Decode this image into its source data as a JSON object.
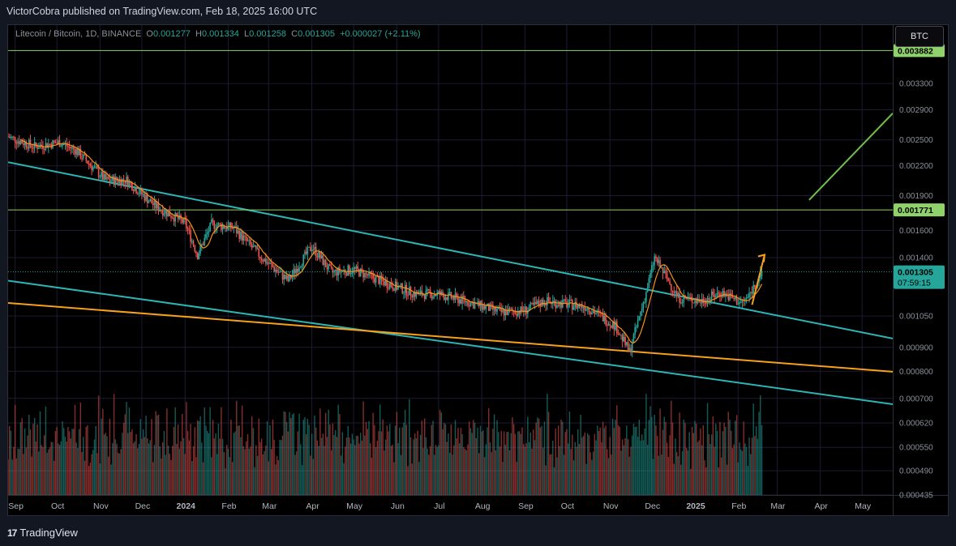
{
  "header": {
    "publisher": "VictorCobra published on TradingView.com, Feb 18, 2025 16:00 UTC"
  },
  "legend": {
    "symbol": "Litecoin / Bitcoin, 1D, BINANCE",
    "o_label": "O",
    "o_value": "0.001277",
    "h_label": "H",
    "h_value": "0.001334",
    "l_label": "L",
    "l_value": "0.001258",
    "c_label": "C",
    "c_value": "0.001305",
    "change": "+0.000027 (+2.11%)"
  },
  "symbol_box": "BTC",
  "footer": {
    "brand": "TradingView",
    "logo_mark": "17"
  },
  "colors": {
    "background": "#000000",
    "grid": "#1e1a33",
    "up": "#26a69a",
    "down": "#ef5350",
    "ma": "#f7931a",
    "channel": "#2db5b5",
    "orange_line": "#f7a11a",
    "level_line": "#8fd16a",
    "projection": "#6fc24a"
  },
  "chart_data": {
    "type": "candlestick",
    "title": "Litecoin / Bitcoin, 1D, BINANCE",
    "scale": "log",
    "ylim": [
      0.000435,
      0.0044
    ],
    "y_ticks": [
      "0.003300",
      "0.002900",
      "0.002500",
      "0.002200",
      "0.001900",
      "0.001600",
      "0.001400",
      "0.001050",
      "0.000900",
      "0.000800",
      "0.000700",
      "0.000620",
      "0.000550",
      "0.000490",
      "0.000435"
    ],
    "x_ticks": [
      "Sep",
      "Oct",
      "Nov",
      "Dec",
      "2024",
      "Feb",
      "Mar",
      "Apr",
      "May",
      "Jun",
      "Jul",
      "Aug",
      "Sep",
      "Oct",
      "Nov",
      "Dec",
      "2025",
      "Feb",
      "Mar",
      "Apr",
      "May"
    ],
    "x_tick_bold": [
      "2024",
      "2025"
    ],
    "x_range": [
      "2023-08-27",
      "2025-05-23"
    ],
    "last_date": "2025-02-18",
    "price_path": [
      {
        "date": "2023-08-27",
        "price": 0.00254
      },
      {
        "date": "2023-09-15",
        "price": 0.00242
      },
      {
        "date": "2023-10-03",
        "price": 0.00247
      },
      {
        "date": "2023-10-15",
        "price": 0.00237
      },
      {
        "date": "2023-11-05",
        "price": 0.00205
      },
      {
        "date": "2023-11-20",
        "price": 0.00205
      },
      {
        "date": "2023-12-10",
        "price": 0.00181
      },
      {
        "date": "2024-01-01",
        "price": 0.00166
      },
      {
        "date": "2024-01-10",
        "price": 0.00142
      },
      {
        "date": "2024-01-20",
        "price": 0.00165
      },
      {
        "date": "2024-02-05",
        "price": 0.00162
      },
      {
        "date": "2024-02-25",
        "price": 0.0014
      },
      {
        "date": "2024-03-15",
        "price": 0.00125
      },
      {
        "date": "2024-04-01",
        "price": 0.00148
      },
      {
        "date": "2024-04-15",
        "price": 0.0013
      },
      {
        "date": "2024-05-01",
        "price": 0.00132
      },
      {
        "date": "2024-05-20",
        "price": 0.00125
      },
      {
        "date": "2024-06-15",
        "price": 0.00117
      },
      {
        "date": "2024-07-01",
        "price": 0.00117
      },
      {
        "date": "2024-07-20",
        "price": 0.00113
      },
      {
        "date": "2024-08-15",
        "price": 0.00107
      },
      {
        "date": "2024-09-01",
        "price": 0.00108
      },
      {
        "date": "2024-09-15",
        "price": 0.00113
      },
      {
        "date": "2024-10-15",
        "price": 0.0011
      },
      {
        "date": "2024-11-05",
        "price": 0.001
      },
      {
        "date": "2024-11-15",
        "price": 0.00088
      },
      {
        "date": "2024-11-27",
        "price": 0.00118
      },
      {
        "date": "2024-12-03",
        "price": 0.0014
      },
      {
        "date": "2024-12-20",
        "price": 0.00115
      },
      {
        "date": "2025-01-05",
        "price": 0.00113
      },
      {
        "date": "2025-01-20",
        "price": 0.00118
      },
      {
        "date": "2025-02-03",
        "price": 0.00112
      },
      {
        "date": "2025-02-08",
        "price": 0.00115
      },
      {
        "date": "2025-02-18",
        "price": 0.001305
      }
    ],
    "volume_scale_label": "relative",
    "horizontal_levels": [
      {
        "price": 0.003882,
        "label": "0.003882"
      },
      {
        "price": 0.001771,
        "label": "0.001771"
      }
    ],
    "last_price": {
      "price": 0.001305,
      "label": "0.001305",
      "countdown": "07:59:15"
    },
    "trend_lines": [
      {
        "name": "channel-top",
        "from": {
          "date": "2023-08-27",
          "price": 0.00224
        },
        "to": {
          "date": "2025-05-23",
          "price": 0.00094
        }
      },
      {
        "name": "channel-bottom",
        "from": {
          "date": "2023-08-27",
          "price": 0.00125
        },
        "to": {
          "date": "2025-05-23",
          "price": 0.00068
        }
      },
      {
        "name": "orange-support",
        "from": {
          "date": "2023-08-27",
          "price": 0.00112
        },
        "to": {
          "date": "2025-05-23",
          "price": 0.000798
        }
      },
      {
        "name": "projection",
        "from": {
          "date": "2025-03-24",
          "price": 0.00186
        },
        "to": {
          "date": "2025-05-23",
          "price": 0.00285
        }
      }
    ],
    "breakout_arrow": {
      "from": {
        "date": "2025-02-11",
        "price": 0.00111
      },
      "to": {
        "date": "2025-02-20",
        "price": 0.00142
      }
    },
    "grid": true
  }
}
